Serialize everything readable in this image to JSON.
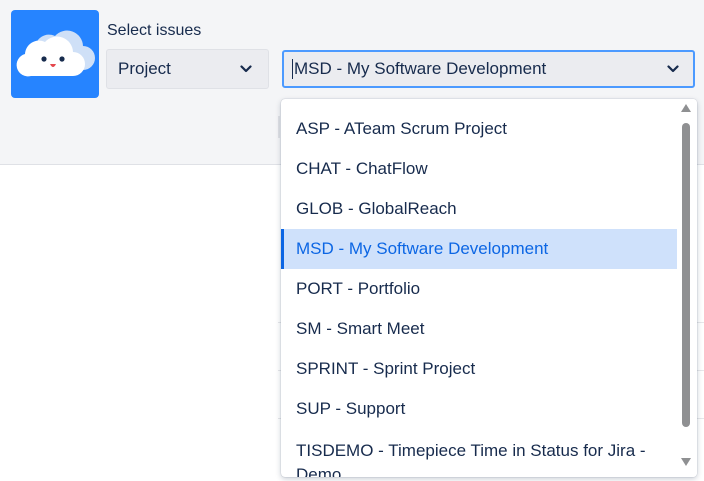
{
  "filter": {
    "label": "Select issues",
    "type_select": {
      "value": "Project"
    },
    "project_select": {
      "value": "MSD - My Software Development"
    }
  },
  "dropdown": {
    "options": [
      {
        "label": "ASP - ATeam Scrum Project",
        "selected": false
      },
      {
        "label": "CHAT - ChatFlow",
        "selected": false
      },
      {
        "label": "GLOB - GlobalReach",
        "selected": false
      },
      {
        "label": "MSD - My Software Development",
        "selected": true
      },
      {
        "label": "PORT - Portfolio",
        "selected": false
      },
      {
        "label": "SM - Smart Meet",
        "selected": false
      },
      {
        "label": "SPRINT - Sprint Project",
        "selected": false
      },
      {
        "label": "SUP - Support",
        "selected": false
      },
      {
        "label": "TISDEMO - Timepiece Time in Status for Jira - Demo",
        "selected": false
      }
    ]
  },
  "colors": {
    "accent": "#2684ff",
    "selected_bg": "#cfe1fb",
    "selected_text": "#0c66e4",
    "focus_border": "#4c9aff"
  },
  "icons": {
    "logo": "cloud-mascot-icon",
    "select_chevron": "chevron-down-icon",
    "scroll_up": "scroll-up-arrow-icon",
    "scroll_down": "scroll-down-arrow-icon"
  }
}
